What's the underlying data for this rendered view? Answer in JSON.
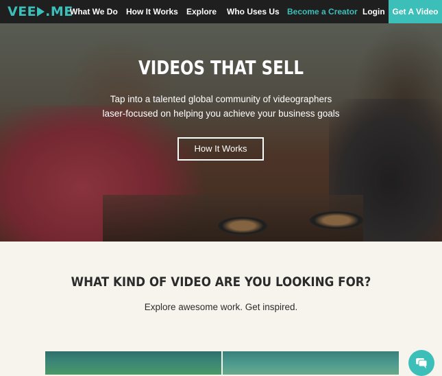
{
  "nav": {
    "logo": {
      "left": "VEE",
      "right": "ME"
    },
    "items": [
      {
        "label": "What We Do"
      },
      {
        "label": "How It Works"
      },
      {
        "label": "Explore"
      },
      {
        "label": "Who Uses Us"
      },
      {
        "label": "Become a Creator"
      },
      {
        "label": "Login"
      }
    ],
    "cta": "Get A Video"
  },
  "hero": {
    "title": "VIDEOS THAT SELL",
    "subtitle_line1": "Tap into a talented global community of videographers",
    "subtitle_line2": "laser-focused on helping you achieve your business goals",
    "button": "How It Works"
  },
  "section": {
    "title": "WHAT KIND OF VIDEO ARE YOU LOOKING FOR?",
    "subtitle": "Explore awesome work. Get inspired."
  },
  "icons": {
    "chat": "chat-bubble-icon",
    "logo_play": "play-triangle-icon"
  },
  "colors": {
    "accent": "#3dbfb9",
    "nav_bg": "#1f1f1f",
    "page_bg": "#f7f4ee"
  }
}
